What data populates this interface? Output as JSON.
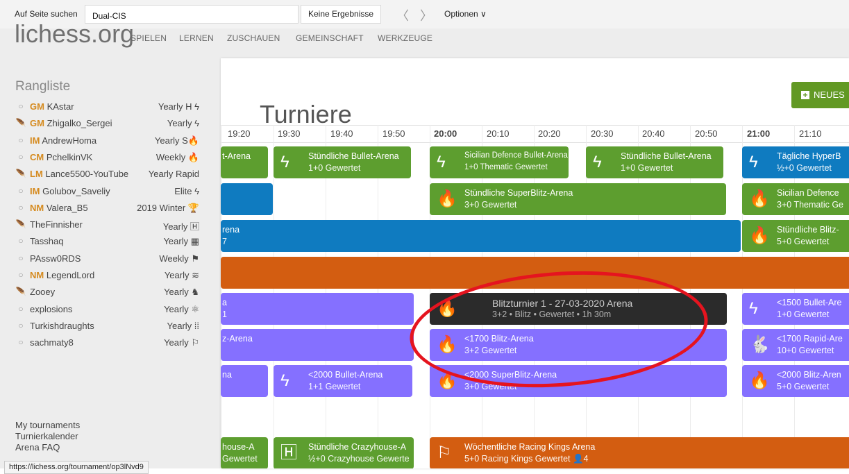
{
  "findbar": {
    "label": "Auf Seite suchen",
    "query": "Dual-CIS",
    "result": "Keine Ergebnisse",
    "prev": "〈",
    "next": "〉",
    "options": "Optionen ∨"
  },
  "site": {
    "logo": "lichess.org",
    "nav": [
      "SPIELEN",
      "LERNEN",
      "ZUSCHAUEN",
      "GEMEINSCHAFT",
      "WERKZEUGE"
    ]
  },
  "leaderboard": {
    "title": "Rangliste",
    "rows": [
      {
        "mark": "○",
        "title": "GM",
        "name": "KAstar",
        "right": "Yearly H ϟ"
      },
      {
        "mark": "🪶",
        "title": "GM",
        "name": "Zhigalko_Sergei",
        "right": "Yearly ϟ"
      },
      {
        "mark": "○",
        "title": "IM",
        "name": "AndrewHoma",
        "right": "Yearly S🔥"
      },
      {
        "mark": "○",
        "title": "CM",
        "name": "PchelkinVK",
        "right": "Weekly 🔥"
      },
      {
        "mark": "🪶",
        "title": "LM",
        "name": "Lance5500-YouTube",
        "right": "Yearly Rapid"
      },
      {
        "mark": "○",
        "title": "IM",
        "name": "Golubov_Saveliy",
        "right": "Elite ϟ"
      },
      {
        "mark": "○",
        "title": "NM",
        "name": "Valera_B5",
        "right": "2019 Winter 🏆"
      },
      {
        "mark": "🪶",
        "title": "",
        "name": "TheFinnisher",
        "right": "Yearly 🄷"
      },
      {
        "mark": "○",
        "title": "",
        "name": "Tasshaq",
        "right": "Yearly ▦"
      },
      {
        "mark": "○",
        "title": "",
        "name": "PAssw0RDS",
        "right": "Weekly ⚑"
      },
      {
        "mark": "○",
        "title": "NM",
        "name": "LegendLord",
        "right": "Yearly ≋"
      },
      {
        "mark": "🪶",
        "title": "",
        "name": "Zooey",
        "right": "Yearly ♞"
      },
      {
        "mark": "○",
        "title": "",
        "name": "explosions",
        "right": "Yearly ⚛"
      },
      {
        "mark": "○",
        "title": "",
        "name": "Turkishdraughts",
        "right": "Yearly ⁞⁞"
      },
      {
        "mark": "○",
        "title": "",
        "name": "sachmaty8",
        "right": "Yearly ⚐"
      }
    ],
    "links": [
      "My tournaments",
      "Turnierkalender",
      "Arena FAQ"
    ]
  },
  "statusbar": "https://lichess.org/tournament/op3lNvd9",
  "page": {
    "title": "Turniere",
    "new_button": "NEUES"
  },
  "timeline": [
    "19:20",
    "19:30",
    "19:40",
    "19:50",
    "20:00",
    "20:10",
    "20:20",
    "20:30",
    "20:40",
    "20:50",
    "21:00",
    "21:10"
  ],
  "events": [
    {
      "t1": "t-Arena",
      "t2": ""
    },
    {
      "t1": "Stündliche Bullet-Arena",
      "t2": "1+0 Gewertet"
    },
    {
      "t1": "Sicilian Defence Bullet-Arena",
      "t2": "1+0 Thematic Gewertet"
    },
    {
      "t1": "Stündliche Bullet-Arena",
      "t2": "1+0 Gewertet"
    },
    {
      "t1": "Tägliche HyperB",
      "t2": "½+0 Gewertet"
    },
    {
      "t1": "Stündliche SuperBlitz-Arena",
      "t2": "3+0 Gewertet"
    },
    {
      "t1": "Sicilian Defence",
      "t2": "3+0 Thematic Ge"
    },
    {
      "t1": "rena",
      "t2": "7"
    },
    {
      "t1": "Stündliche Blitz-",
      "t2": "5+0 Gewertet"
    },
    {
      "t1": "a",
      "t2": "1"
    },
    {
      "t1": "Blitzturnier 1 - 27-03-2020 Arena",
      "t2": "3+2 • Blitz • Gewertet • 1h 30m"
    },
    {
      "t1": "<1500 Bullet-Are",
      "t2": "1+0 Gewertet"
    },
    {
      "t1": "z-Arena",
      "t2": ""
    },
    {
      "t1": "<1700 Blitz-Arena",
      "t2": "3+2 Gewertet"
    },
    {
      "t1": "<1700 Rapid-Are",
      "t2": "10+0 Gewertet"
    },
    {
      "t1": "na",
      "t2": ""
    },
    {
      "t1": "<2000 Bullet-Arena",
      "t2": "1+1 Gewertet"
    },
    {
      "t1": "<2000 SuperBlitz-Arena",
      "t2": "3+0 Gewertet"
    },
    {
      "t1": "<2000 Blitz-Aren",
      "t2": "5+0 Gewertet"
    },
    {
      "t1": "house-A",
      "t2": "Gewertet"
    },
    {
      "t1": "Stündliche Crazyhouse-A",
      "t2": "½+0 Crazyhouse Gewerte"
    },
    {
      "t1": "Wöchentliche Racing Kings Arena",
      "t2": "5+0 Racing Kings Gewertet 👤4"
    }
  ],
  "colors": {
    "accent": "#629924",
    "green": "#5d9e2f",
    "blue": "#0f7bc0",
    "orange": "#d35d11",
    "purple": "#8570ff",
    "annotation": "#e5141f"
  }
}
